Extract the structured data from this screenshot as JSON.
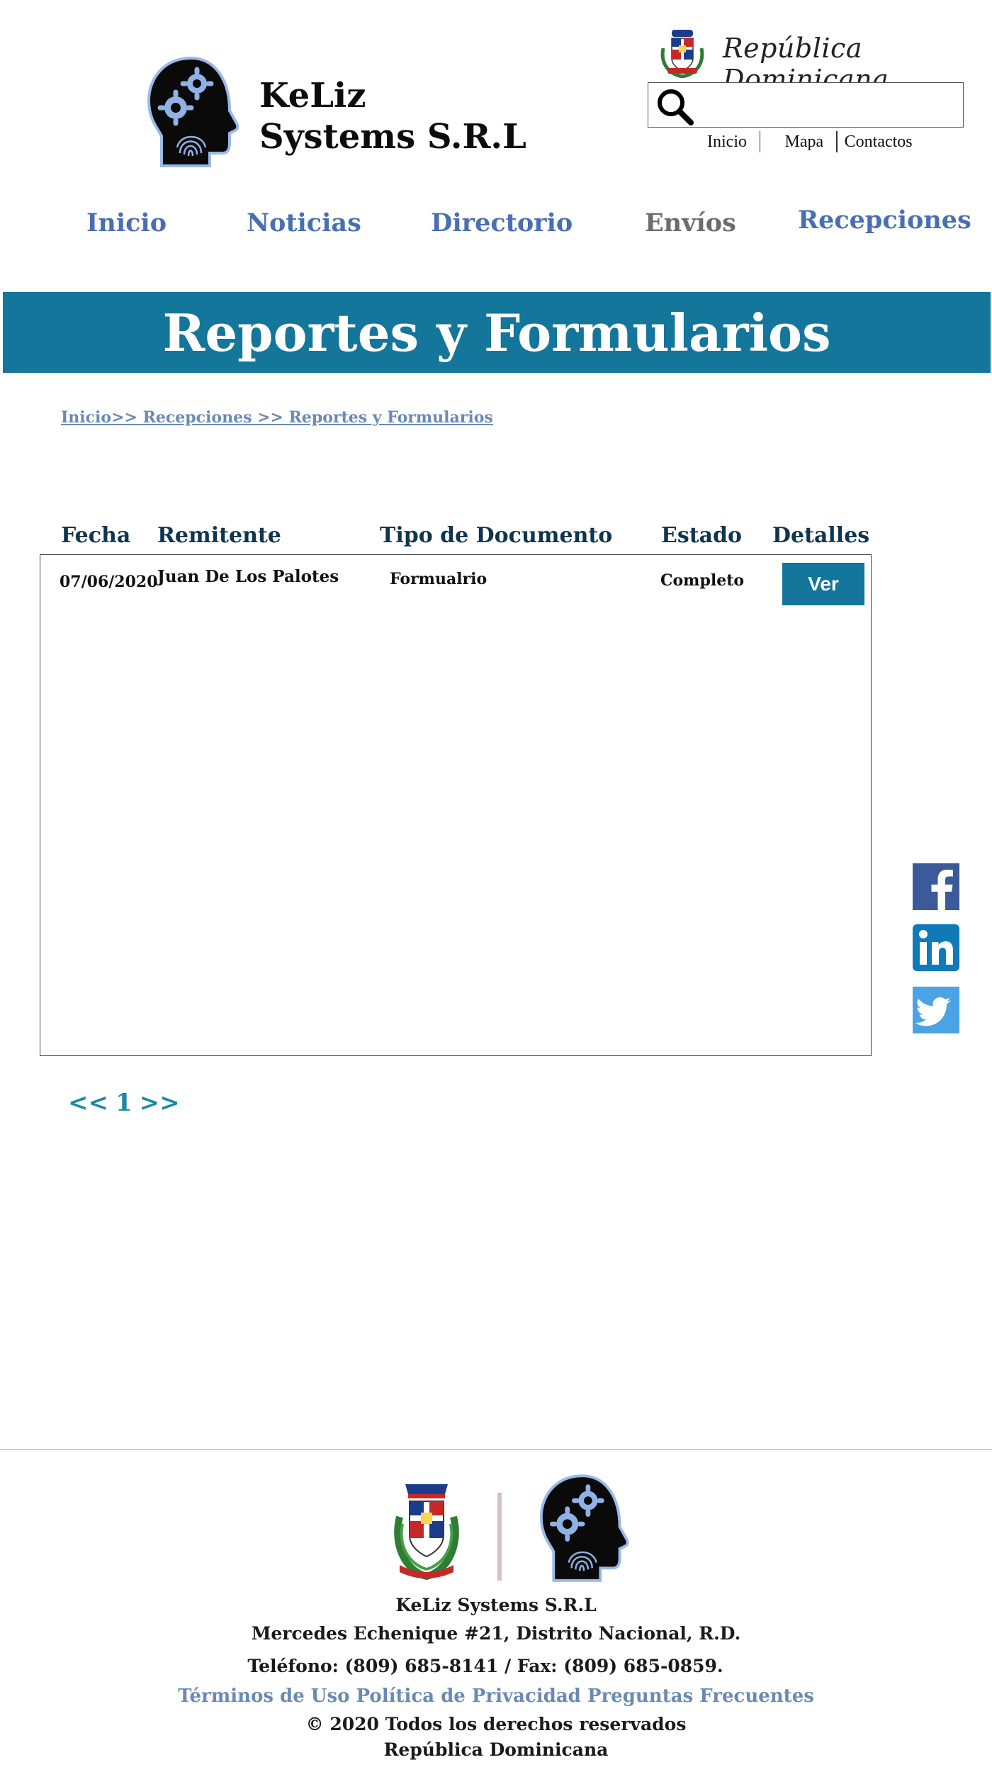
{
  "header": {
    "company_name_line1": "KeLiz",
    "company_name_line2": "Systems S.R.L",
    "country": "República Dominicana",
    "search": {
      "value": "",
      "placeholder": ""
    },
    "top_links": [
      "Inicio",
      "Mapa",
      "Contactos"
    ]
  },
  "nav": {
    "items": [
      {
        "label": "Inicio",
        "active": true
      },
      {
        "label": "Noticias",
        "active": true
      },
      {
        "label": "Directorio",
        "active": true
      },
      {
        "label": "Envíos",
        "active": false
      },
      {
        "label": "Recepciones",
        "active": true
      }
    ]
  },
  "banner": {
    "title": "Reportes y Formularios"
  },
  "breadcrumb": "Inicio>> Recepciones >> Reportes y Formularios",
  "table": {
    "columns": [
      "Fecha",
      "Remitente",
      "Tipo de Documento",
      "Estado",
      "Detalles"
    ],
    "rows": [
      {
        "fecha": "07/06/2020",
        "remitente": "Juan De Los Palotes",
        "tipo": "Formualrio",
        "estado": "Completo",
        "detalles": "Ver"
      }
    ]
  },
  "pagination": {
    "prev": "<<",
    "page": "1",
    "next": ">>"
  },
  "social": [
    "facebook-icon",
    "linkedin-icon",
    "twitter-icon"
  ],
  "colors": {
    "brand": "#13769a",
    "nav": "#4a6fb1",
    "link": "#6a8ab5",
    "heading": "#0f3550",
    "pagination": "#1a8aa4"
  },
  "footer": {
    "company": "KeLiz Systems S.R.L",
    "address": "Mercedes Echenique #21, Distrito Nacional, R.D.",
    "phone": "Teléfono: (809) 685-8141 / Fax: (809) 685-0859.",
    "links": [
      "Términos de Uso",
      "Política de Privacidad",
      "Preguntas Frecuentes"
    ],
    "copyright": "© 2020 Todos los derechos reservados",
    "country": "República Dominicana"
  }
}
